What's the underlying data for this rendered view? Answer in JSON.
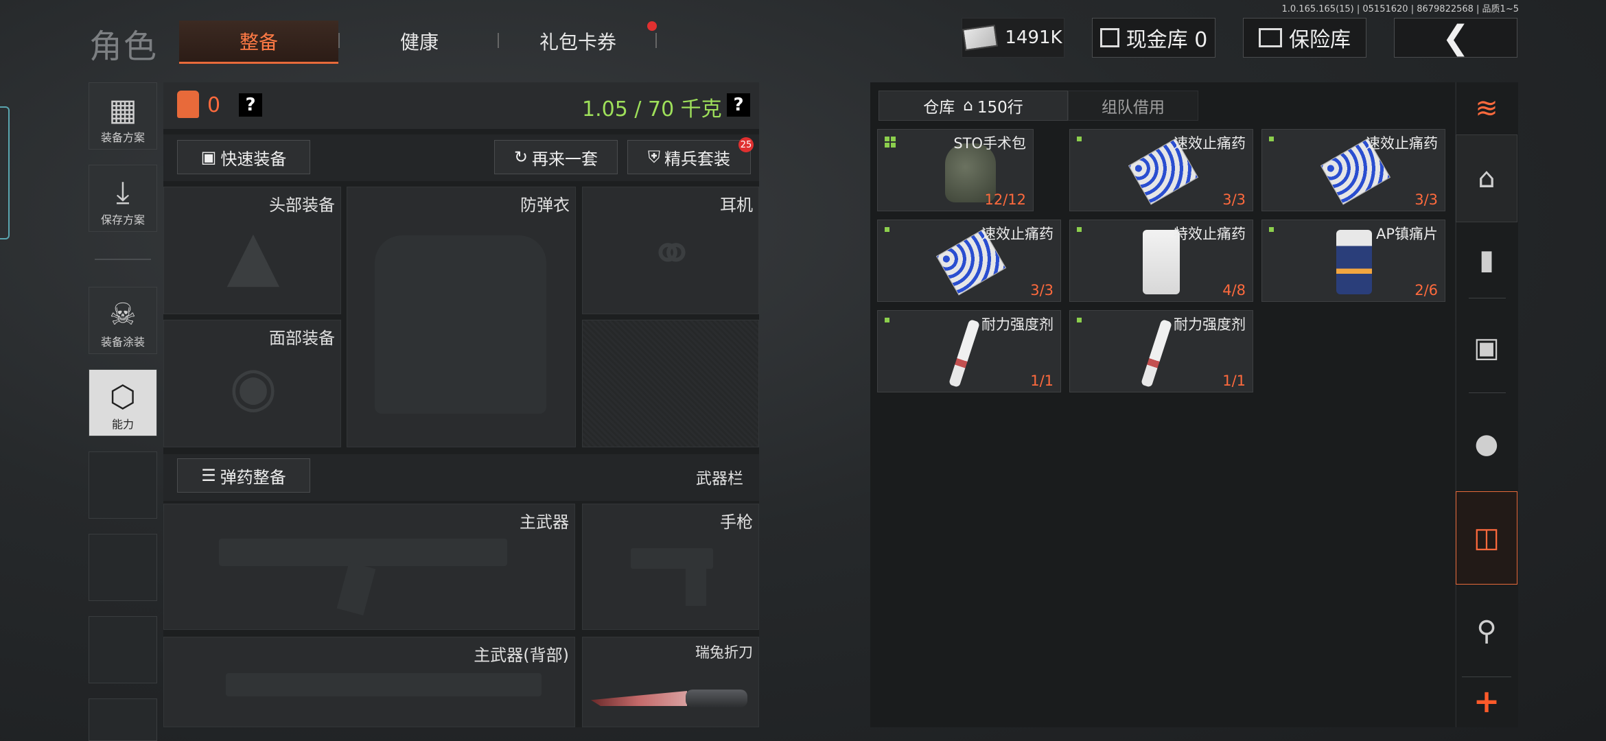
{
  "version": "1.0.165.165(15) | 05151620 | 8679822568 | 品质1~5",
  "title": "角色",
  "tabs": [
    "整备",
    "健康",
    "礼包卡券"
  ],
  "top": {
    "money": "1491K",
    "cash_vault": "现金库 0",
    "safe": "保险库"
  },
  "sidebar": [
    "装备方案",
    "保存方案",
    "装备涂装",
    "能力"
  ],
  "loadout": {
    "armor_count": "0",
    "weight": "1.05 / 70 千克",
    "quick_equip": "快速装备",
    "repeat": "再来一套",
    "elite": "精兵套装",
    "elite_badge": "25",
    "slots": {
      "head": "头部装备",
      "vest": "防弹衣",
      "earphone": "耳机",
      "face": "面部装备"
    },
    "ammo": "弹药整备",
    "weapon_bar": "武器栏",
    "weapons": {
      "primary": "主武器",
      "pistol": "手枪",
      "primary_back": "主武器(背部)",
      "knife": "瑞兔折刀"
    }
  },
  "warehouse": {
    "tab_storage": "仓库",
    "tab_rows": "150行",
    "tab_team": "组队借用",
    "items": [
      {
        "name": "STO手术包",
        "count": "12/12"
      },
      {
        "name": "速效止痛药",
        "count": "3/3"
      },
      {
        "name": "速效止痛药",
        "count": "3/3"
      },
      {
        "name": "速效止痛药",
        "count": "3/3"
      },
      {
        "name": "特效止痛药",
        "count": "4/8"
      },
      {
        "name": "AP镇痛片",
        "count": "2/6"
      },
      {
        "name": "耐力强度剂",
        "count": "1/1"
      },
      {
        "name": "耐力强度剂",
        "count": "1/1"
      }
    ]
  },
  "icons": [
    "cash-icon",
    "vault-icon",
    "safe-icon",
    "back-arrow-icon",
    "vest-icon",
    "help-icon",
    "layers-refresh-icon",
    "home-icon",
    "ammo-icon",
    "optic-icon",
    "grenade-icon",
    "storage-icon",
    "key-icon",
    "plus-icon"
  ],
  "colors": {
    "accent": "#ff6a3d",
    "weight_green": "#9ee05a",
    "dot_green": "#8ccf4d"
  }
}
